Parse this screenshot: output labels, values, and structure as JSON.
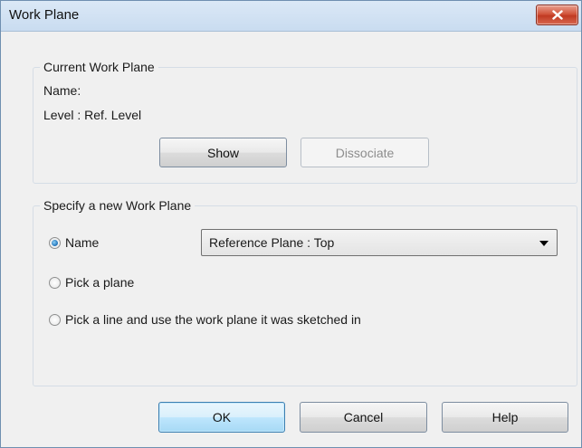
{
  "window": {
    "title": "Work Plane"
  },
  "current_work_plane": {
    "legend": "Current Work Plane",
    "name_label": "Name:",
    "name_value": "Level : Ref. Level",
    "show_label": "Show",
    "dissociate_label": "Dissociate"
  },
  "new_work_plane": {
    "legend": "Specify a new Work Plane",
    "options": [
      {
        "label": "Name",
        "checked": true
      },
      {
        "label": "Pick a plane",
        "checked": false
      },
      {
        "label": "Pick a line and use the work plane it was sketched in",
        "checked": false
      }
    ],
    "name_select": {
      "value": "Reference Plane : Top"
    }
  },
  "footer": {
    "ok_label": "OK",
    "cancel_label": "Cancel",
    "help_label": "Help"
  },
  "icons": {
    "close": "close-icon",
    "dropdown": "chevron-down-icon"
  },
  "colors": {
    "titlebar": "#c9dcf0",
    "close_button": "#c13a22",
    "default_button_border": "#3c7fb1",
    "dialog_background": "#f0f0f0"
  }
}
